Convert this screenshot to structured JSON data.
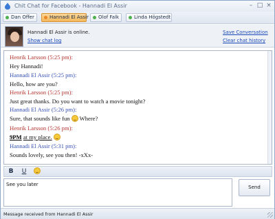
{
  "window": {
    "title": "Chit Chat for Facebook - Hannadi El Assir",
    "minimize": "–",
    "maximize": "□",
    "close": "×"
  },
  "tabs": [
    {
      "label": "Dan Offer",
      "active": false
    },
    {
      "label": "Hannadi El Assir",
      "active": true
    },
    {
      "label": "Olof Falk",
      "active": false
    },
    {
      "label": "Linda Högstedt",
      "active": false
    }
  ],
  "contact": {
    "status": "Hannadi El Assir is online.",
    "show_log": "Show chat log",
    "save_conversation": "Save Conversation",
    "clear_history": "Clear chat history"
  },
  "messages": [
    {
      "sender": "Henrik Larsson",
      "time": "(5:25 pm):",
      "text": "Hey Hannadi!"
    },
    {
      "sender": "Hannadi El Assir",
      "time": "(5:25 pm):",
      "text": "Hello, how are you?"
    },
    {
      "sender": "Henrik Larsson",
      "time": "(5:25 pm):",
      "text": "Just great thanks. Do you want to watch a movie tonight?"
    },
    {
      "sender": "Hannadi El Assir",
      "time": "(5:26 pm):",
      "text_a": "Sure, that sounds like fun",
      "text_b": "Where?"
    },
    {
      "sender": "Henrik Larsson",
      "time": "(5:26 pm):",
      "text_bold": "9PM",
      "text": "at my place."
    },
    {
      "sender": "Hannadi El Assir",
      "time": "(5:31 pm):",
      "text": "Sounds lovely, see you then! -xXx-"
    }
  ],
  "format": {
    "bold": "B",
    "underline": "U",
    "emoticon": "emoticon-icon"
  },
  "input": {
    "value": "See you later"
  },
  "send_label": "Send",
  "status_bar": "Message received from Hannadi El Assir",
  "colors": {
    "henrik": "#b5342e",
    "hannadi": "#3651b3",
    "active_tab": "#f4b85c"
  }
}
